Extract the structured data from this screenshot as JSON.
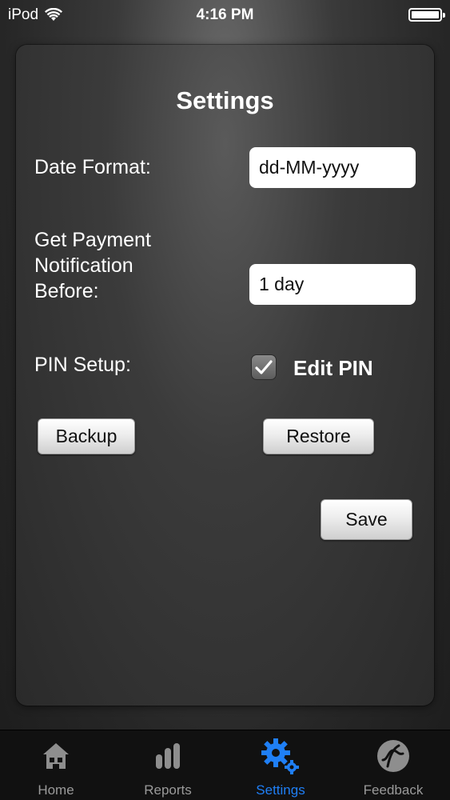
{
  "status_bar": {
    "carrier": "iPod",
    "time": "4:16 PM"
  },
  "panel": {
    "title": "Settings",
    "date_format": {
      "label": "Date Format:",
      "value": "dd-MM-yyyy"
    },
    "payment_notification": {
      "label_line1": "Get Payment",
      "label_line2": "Notification",
      "label_line3": "Before:",
      "value": "1 day"
    },
    "pin_setup": {
      "label": "PIN Setup:",
      "checkbox_label": "Edit PIN",
      "checked": true
    },
    "backup_label": "Backup",
    "restore_label": "Restore",
    "save_label": "Save"
  },
  "tab_bar": {
    "active_color": "#1f7ff5",
    "tabs": [
      {
        "label": "Home",
        "icon": "home-icon"
      },
      {
        "label": "Reports",
        "icon": "bar-chart-icon"
      },
      {
        "label": "Settings",
        "icon": "gears-icon",
        "active": true
      },
      {
        "label": "Feedback",
        "icon": "feedback-icon"
      }
    ]
  }
}
